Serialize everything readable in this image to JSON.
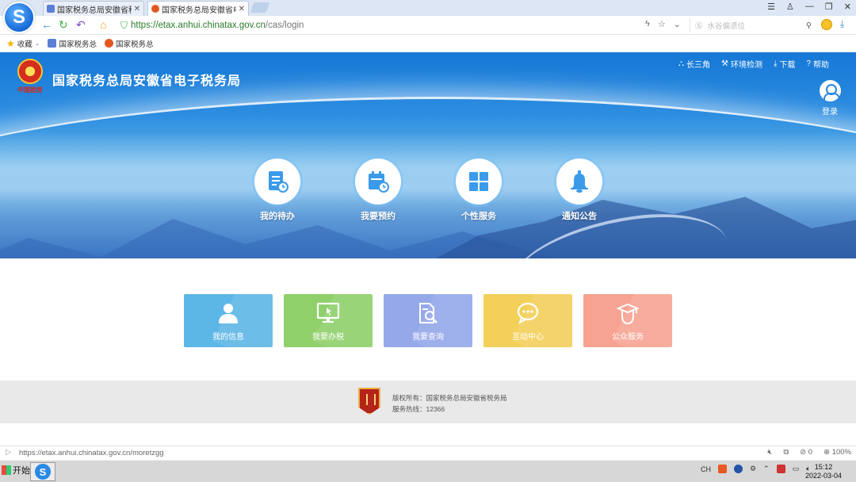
{
  "browser": {
    "tabs": [
      {
        "label": "国家税务总局安徽省税务",
        "close": "✕"
      },
      {
        "label": "国家税务总局安徽省电子",
        "close": "✕"
      }
    ],
    "url_host": "https://etax.anhui.chinatax.gov.cn",
    "url_path": "/cas/login",
    "search_placeholder": "水谷偏退位",
    "bookmarks": [
      {
        "label": "收藏",
        "icon": "star-icon"
      },
      {
        "label": "国家税务总",
        "icon": "tax-favicon"
      },
      {
        "label": "国家税务总",
        "icon": "tax-emblem-favicon"
      }
    ],
    "status_url": "https://etax.anhui.chinatax.gov.cn/moretzgg",
    "status_right": {
      "badge": "0",
      "zoom": "100%"
    }
  },
  "page": {
    "title": "国家税务总局安徽省电子税务局",
    "emblem_tag": "中国税务",
    "top_nav": [
      {
        "label": "长三角",
        "icon": "network-icon"
      },
      {
        "label": "环境检测",
        "icon": "wrench-icon"
      },
      {
        "label": "下载",
        "icon": "download-icon"
      },
      {
        "label": "帮助",
        "icon": "help-icon"
      }
    ],
    "login_label": "登录",
    "hero_items": [
      {
        "label": "我的待办",
        "icon": "todo-document-icon"
      },
      {
        "label": "我要预约",
        "icon": "calendar-clock-icon"
      },
      {
        "label": "个性服务",
        "icon": "grid-icon"
      },
      {
        "label": "通知公告",
        "icon": "bell-icon"
      }
    ],
    "cards": [
      {
        "label": "我的信息",
        "icon": "user-icon",
        "color": "#5cb6e6"
      },
      {
        "label": "我要办税",
        "icon": "monitor-icon",
        "color": "#8fd06a"
      },
      {
        "label": "我要查询",
        "icon": "search-document-icon",
        "color": "#94a8ea"
      },
      {
        "label": "互动中心",
        "icon": "chat-icon",
        "color": "#f3d05a"
      },
      {
        "label": "公众服务",
        "icon": "graduate-icon",
        "color": "#f6a392"
      }
    ],
    "footer": {
      "copyright": "版权所有：国家税务总局安徽省税务局",
      "hotline": "服务热线：12366"
    }
  },
  "taskbar": {
    "start_label": "开始",
    "lang": "CH",
    "time": "15:12",
    "date": "2022-03-04"
  }
}
